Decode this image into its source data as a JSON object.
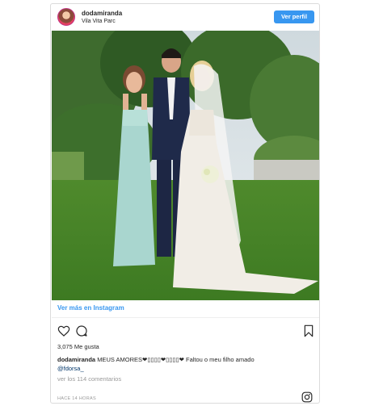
{
  "header": {
    "username": "dodamiranda",
    "location": "Vila Vita Parc",
    "profile_button": "Ver perfil"
  },
  "photo": {
    "alt": "Wedding photo: young woman in mint dress, groom in navy suit, bride in white lace gown on a lawn"
  },
  "footer": {
    "more_link": "Ver más en Instagram",
    "likes": "3,075 Me gusta",
    "caption_user": "dodamiranda",
    "caption_text": "MEUS AMORES❤▯▯▯▯❤▯▯▯▯❤ Faltou o meu filho amado",
    "caption_mention": "@fdorsa_",
    "comments": "ver los 114 comentarios",
    "time_ago": "HACE 14 HORAS"
  },
  "icons": [
    "heart-icon",
    "comment-icon",
    "bookmark-icon",
    "instagram-icon"
  ],
  "colors": {
    "accent": "#3897f0",
    "text": "#262626",
    "muted": "#999999",
    "border": "#dbdbdb"
  }
}
